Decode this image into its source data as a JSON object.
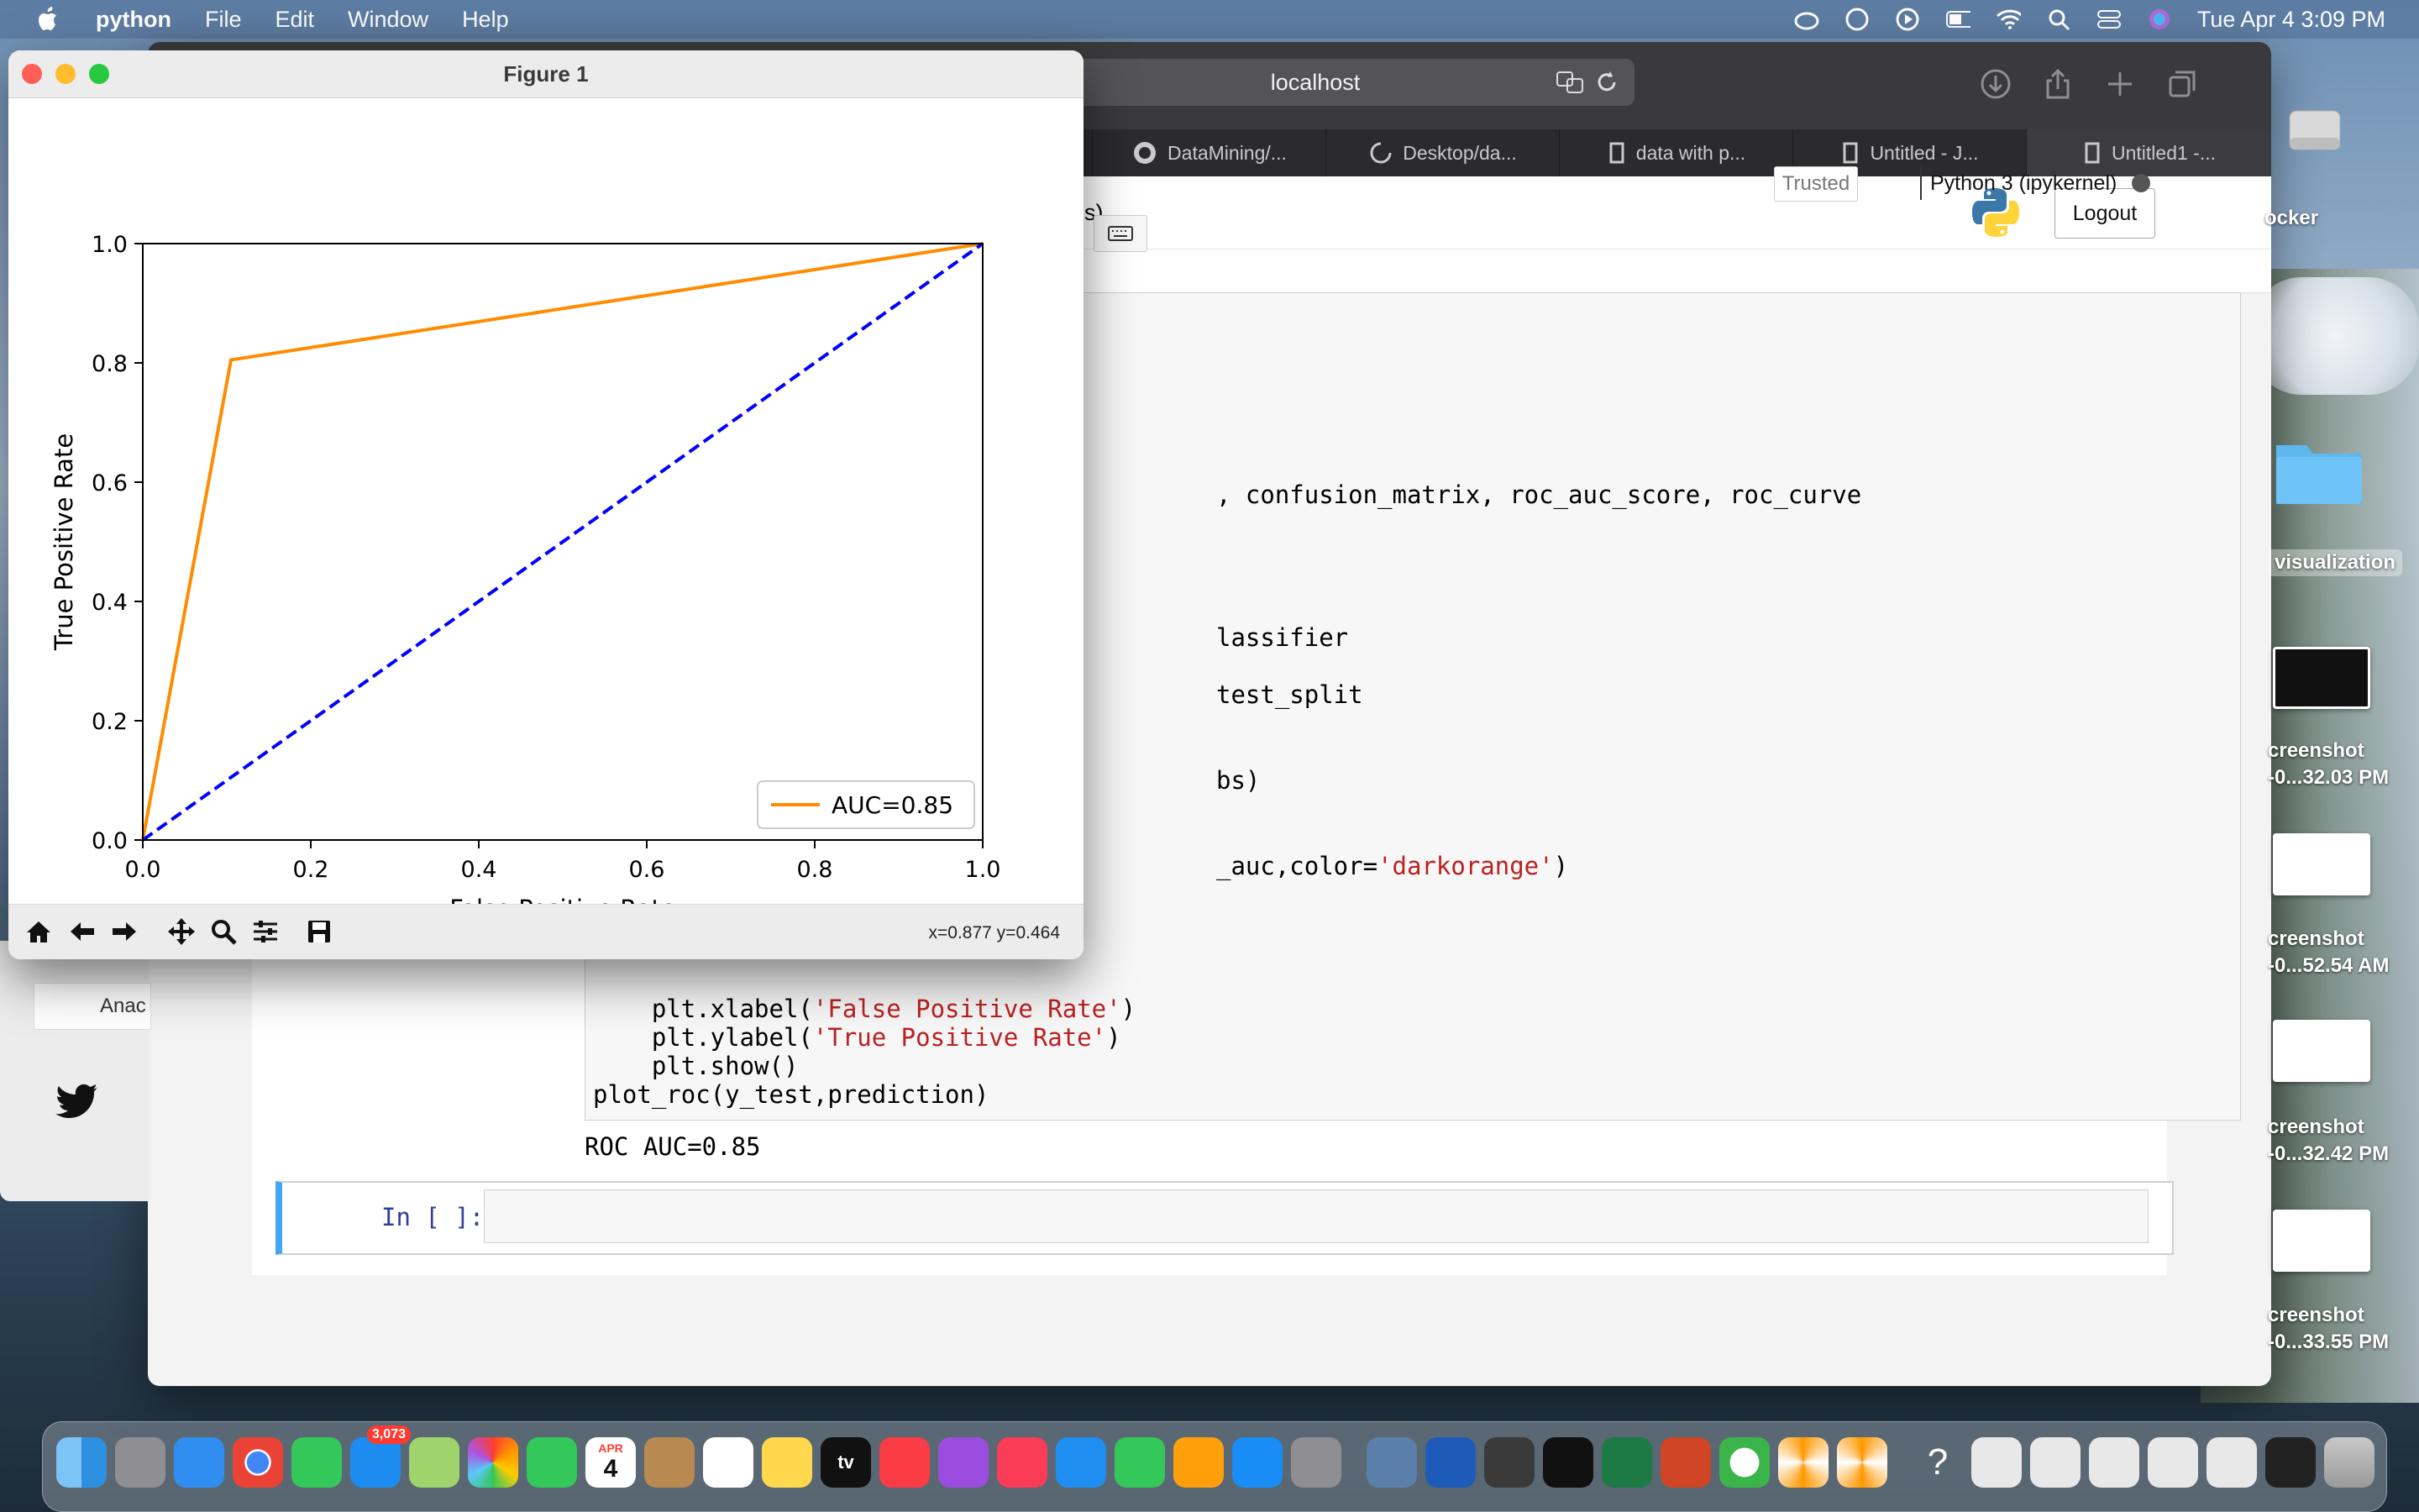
{
  "menubar": {
    "app_name": "python",
    "menus": [
      "File",
      "Edit",
      "Window",
      "Help"
    ],
    "datetime": "Tue Apr 4  3:09 PM"
  },
  "browser": {
    "address": "localhost",
    "tabs": [
      "DataMining/...",
      "Desktop/da...",
      "data with p...",
      "Untitled - J...",
      "Untitled1 -..."
    ],
    "breadcrumb_fragment": "es)",
    "logout_label": "Logout",
    "trusted_label": "Trusted",
    "kernel_label": "Python 3 (ipykernel)"
  },
  "notebook": {
    "code_lines": [
      ", confusion_matrix, roc_auc_score, roc_curve",
      "lassifier",
      "test_split",
      "bs)",
      "_auc,color=",
      "'darkorange'",
      ")",
      "    plt.xlabel(",
      "'False Positive Rate'",
      ")",
      "    plt.ylabel(",
      "'True Positive Rate'",
      ")",
      "    plt.show()",
      "plot_roc(y_test,prediction)"
    ],
    "output": "ROC AUC=0.85",
    "prompt": "In [ ]:"
  },
  "left_window": {
    "button_fragment": "Anac"
  },
  "figure": {
    "window_title": "Figure 1",
    "coords_readout": "x=0.877 y=0.464"
  },
  "chart_data": {
    "type": "line",
    "xlabel": "False Positive Rate",
    "ylabel": "True Positive Rate",
    "xlim": [
      0.0,
      1.0
    ],
    "ylim": [
      0.0,
      1.0
    ],
    "xticks": [
      "0.0",
      "0.2",
      "0.4",
      "0.6",
      "0.8",
      "1.0"
    ],
    "yticks": [
      "0.0",
      "0.2",
      "0.4",
      "0.6",
      "0.8",
      "1.0"
    ],
    "legend_placement": "lower-right",
    "series": [
      {
        "name": "AUC=0.85",
        "color": "#ff8c00",
        "style": "solid",
        "x": [
          0.0,
          0.105,
          1.0
        ],
        "y": [
          0.0,
          0.805,
          1.0
        ]
      },
      {
        "color": "#0000ff",
        "style": "dashed",
        "x": [
          0.0,
          1.0
        ],
        "y": [
          0.0,
          1.0
        ]
      }
    ]
  },
  "desktop": {
    "labels": [
      "ocker",
      "visualization",
      "creenshot",
      "-0...32.03 PM",
      "creenshot",
      "-0...52.54 AM",
      "creenshot",
      "-0...32.42 PM",
      "creenshot",
      "-0...33.55 PM"
    ]
  },
  "dock": {
    "mail_badge": "3,073",
    "calendar_month": "APR",
    "calendar_day": "4",
    "tv_label": "tv"
  }
}
